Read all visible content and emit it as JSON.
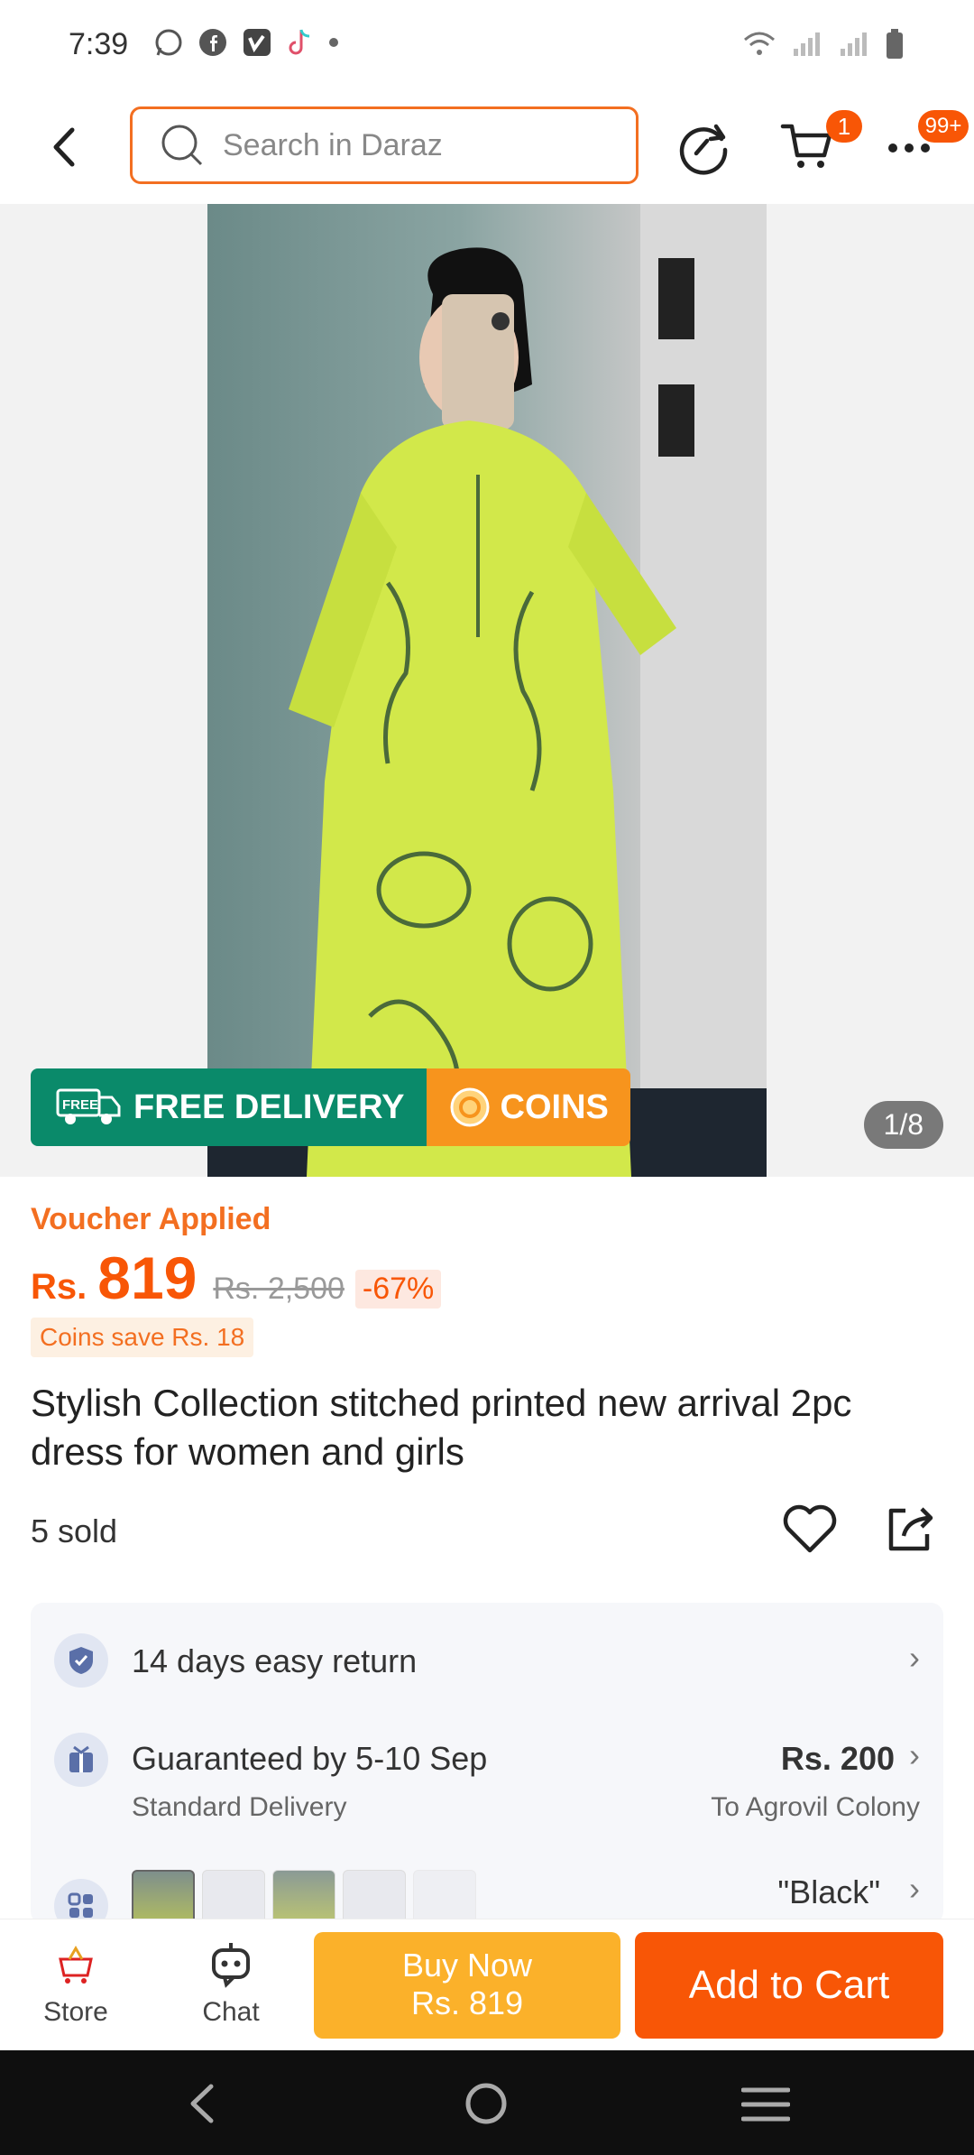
{
  "status_bar": {
    "time": "7:39",
    "left_icons": [
      "whatsapp-icon",
      "facebook-icon",
      "vimeo-icon",
      "tiktok-icon",
      "dot-icon"
    ],
    "right_icons": [
      "wifi-icon",
      "signal-icon",
      "signal-icon",
      "battery-icon"
    ]
  },
  "header": {
    "search_placeholder": "Search in Daraz",
    "cart_badge": "1",
    "more_badge": "99+"
  },
  "gallery": {
    "page_indicator": "1/8",
    "free_delivery_tag": "FREE",
    "free_delivery_label": "FREE DELIVERY",
    "coins_label": "COINS"
  },
  "product": {
    "voucher_label": "Voucher Applied",
    "price_currency": "Rs.",
    "price": "819",
    "original_price": "Rs. 2,500",
    "discount": "-67%",
    "coins_save": "Coins save Rs. 18",
    "title": "Stylish Collection stitched printed new arrival 2pc dress for women and girls",
    "sold": "5 sold"
  },
  "service": {
    "return_text": "14 days easy return",
    "delivery_text": "Guaranteed by 5-10 Sep",
    "delivery_sub": "Standard Delivery",
    "delivery_price": "Rs. 200",
    "delivery_location": "To Agrovil Colony",
    "variant_selected": "\"Black\""
  },
  "bottom_bar": {
    "store_label": "Store",
    "chat_label": "Chat",
    "buy_now_label": "Buy Now",
    "buy_now_price": "Rs. 819",
    "add_to_cart_label": "Add to Cart"
  },
  "colors": {
    "accent": "#f85606",
    "search_border": "#f36f21",
    "buy_now": "#fbb12a",
    "free_delivery": "#0a8a6a",
    "coins": "#f7941d"
  }
}
